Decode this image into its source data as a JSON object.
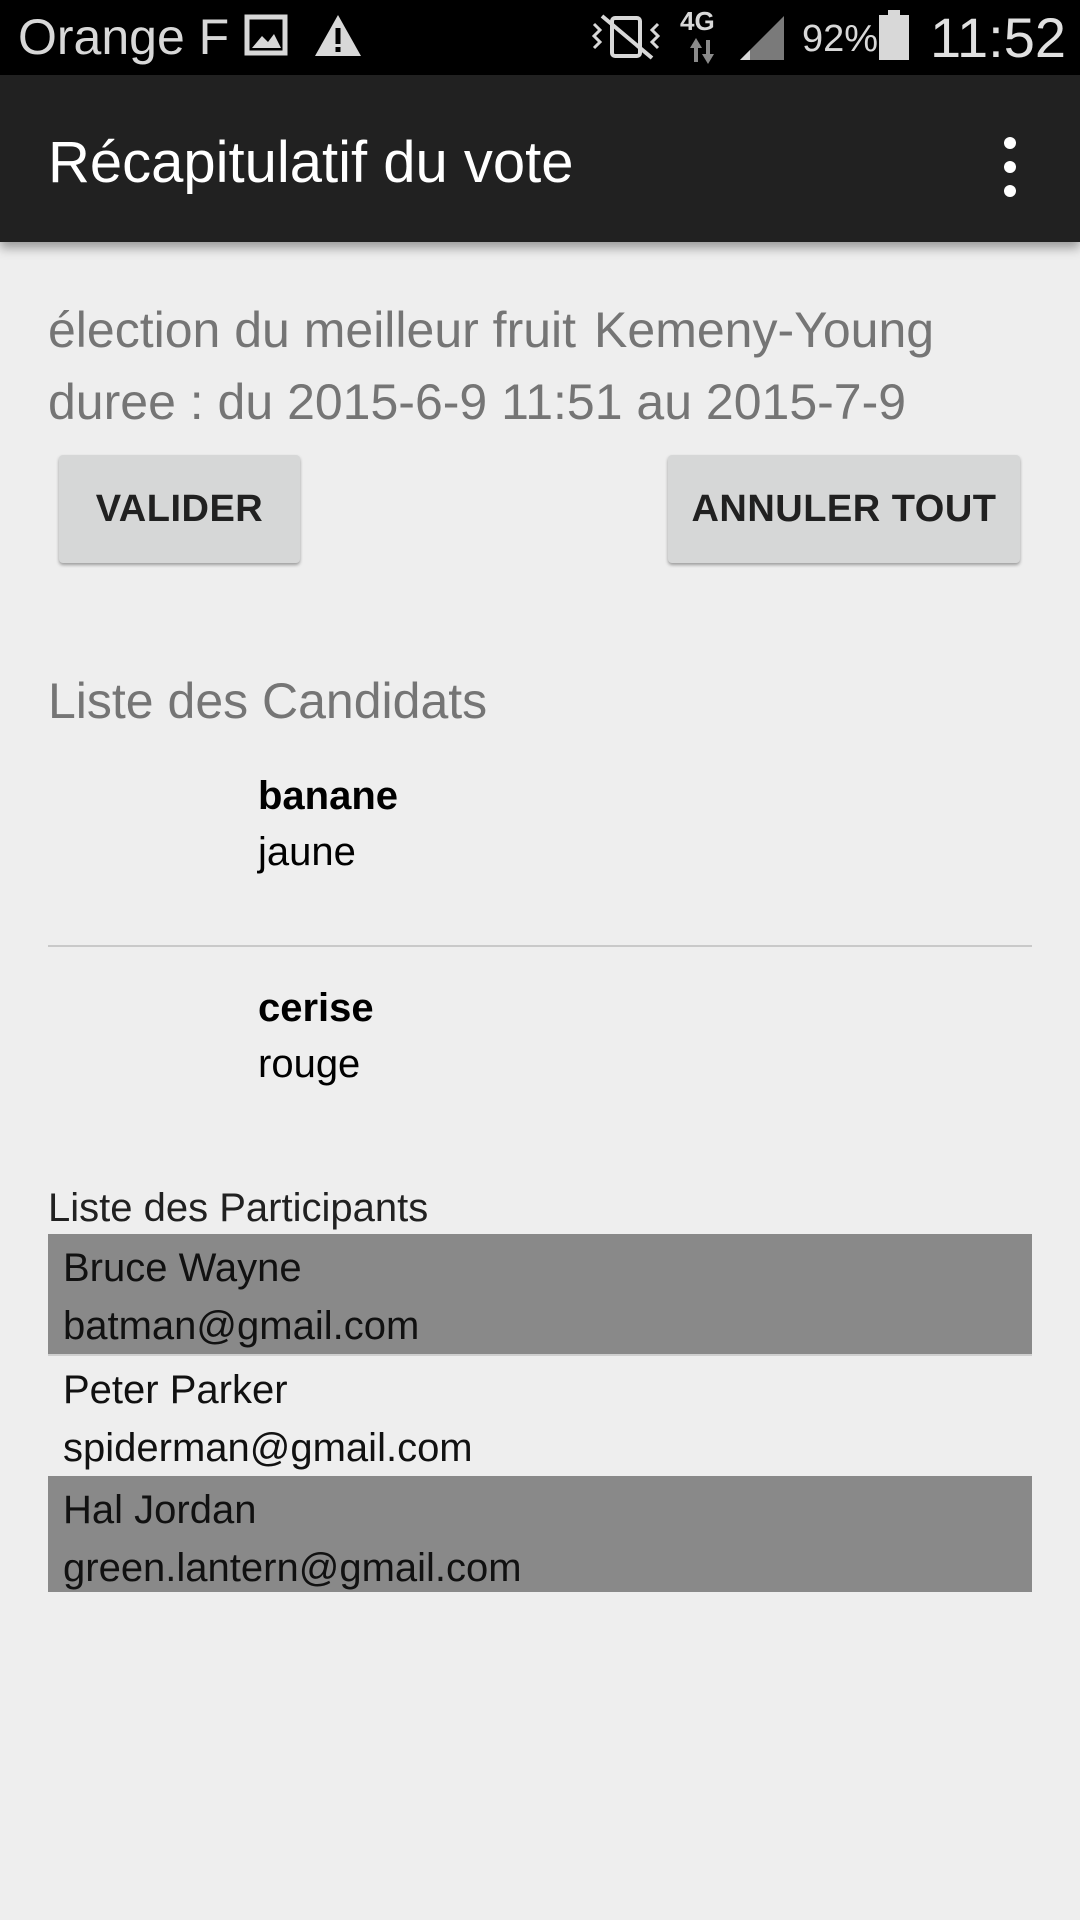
{
  "status_bar": {
    "carrier": "Orange F",
    "network": "4G",
    "battery": "92%",
    "time": "11:52",
    "icons": [
      "image-icon",
      "warning-icon",
      "vibrate-icon",
      "signal-icon",
      "battery-icon"
    ]
  },
  "app_bar": {
    "title": "Récapitulatif du vote",
    "menu_icon": "overflow-menu-icon"
  },
  "election": {
    "name": "élection du meilleur fruit",
    "method": "Kemeny-Young",
    "duration": "duree : du 2015-6-9 11:51 au 2015-7-9",
    "duration_end_time": "11:51"
  },
  "buttons": {
    "validate": "VALIDER",
    "cancel_all": "ANNULER TOUT"
  },
  "candidates": {
    "title": "Liste des Candidats",
    "items": [
      {
        "name": "banane",
        "description": "jaune"
      },
      {
        "name": "cerise",
        "description": "rouge"
      }
    ]
  },
  "participants": {
    "title": "Liste des Participants",
    "items": [
      {
        "name": "Bruce Wayne",
        "email": "batman@gmail.com"
      },
      {
        "name": "Peter Parker",
        "email": "spiderman@gmail.com"
      },
      {
        "name": "Hal Jordan",
        "email": "green.lantern@gmail.com"
      }
    ]
  },
  "colors": {
    "status_bar": "#000000",
    "app_bar": "#212121",
    "background": "#eeeeee",
    "button": "#d6d7d7",
    "row_highlight": "#898989",
    "secondary_text": "#757575"
  }
}
